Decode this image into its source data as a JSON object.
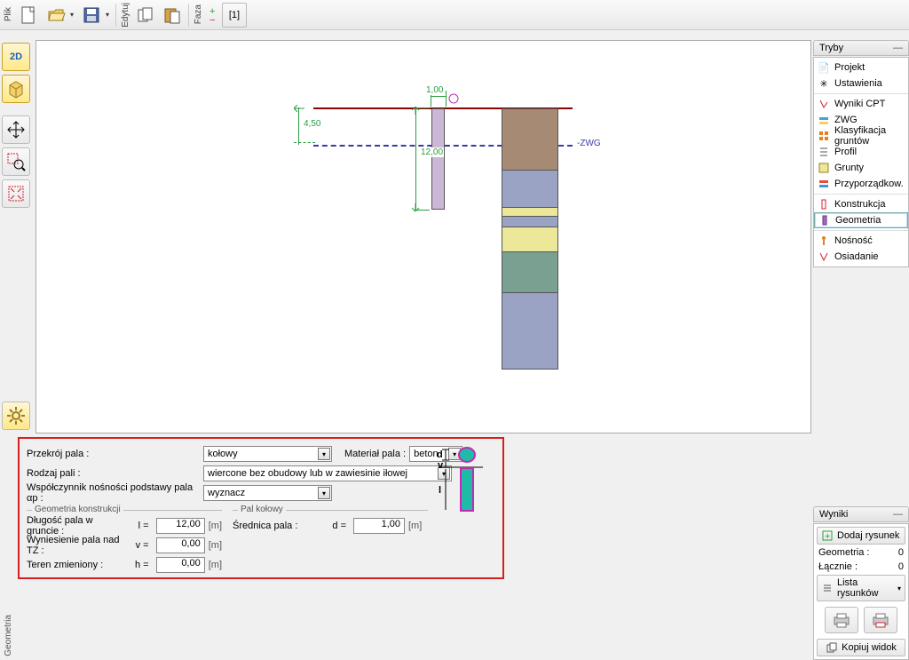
{
  "toolbar": {
    "vlabel_file": "Plik",
    "vlabel_edit": "Edytuj",
    "vlabel_phase": "Faza",
    "phase_btn": "[1]"
  },
  "left": {
    "b2d": "2D",
    "b3d": "3D"
  },
  "right": {
    "modes_header": "Tryby",
    "results_header": "Wyniki",
    "items": [
      "Projekt",
      "Ustawienia",
      "Wyniki CPT",
      "ZWG",
      "Klasyfikacja gruntów",
      "Profil",
      "Grunty",
      "Przyporządkow.",
      "Konstrukcja",
      "Geometria",
      "Nośność",
      "Osiadanie"
    ],
    "add_drawing": "Dodaj rysunek",
    "row_geom_label": "Geometria :",
    "row_geom_val": "0",
    "row_total_label": "Łącznie :",
    "row_total_val": "0",
    "list_drawings": "Lista rysunków",
    "copy_view": "Kopiuj widok"
  },
  "form": {
    "cross_section_label": "Przekrój pala :",
    "cross_section_val": "kołowy",
    "material_label": "Materiał pala :",
    "material_val": "beton",
    "type_label": "Rodzaj pali :",
    "type_val": "wiercone bez obudowy lub w zawiesinie iłowej",
    "coef_label": "Współczynnik nośności podstawy pala αp :",
    "coef_val": "wyznacz",
    "group_geom": "Geometria konstrukcji",
    "group_circ": "Pal kołowy",
    "len_label": "Długość pala w gruncie :",
    "len_var": "l =",
    "len_val": "12,00",
    "len_unit": "[m]",
    "dia_label": "Średnica pala :",
    "dia_var": "d =",
    "dia_val": "1,00",
    "dia_unit": "[m]",
    "rise_label": "Wyniesienie pala nad TZ :",
    "rise_var": "v =",
    "rise_val": "0,00",
    "rise_unit": "[m]",
    "mod_label": "Teren zmieniony :",
    "mod_var": "h =",
    "mod_val": "0,00",
    "mod_unit": "[m]",
    "schem_d": "d",
    "schem_v": "v",
    "schem_l": "l"
  },
  "canvas": {
    "dim_450": "4,50",
    "dim_1200": "12,00",
    "dim_100": "1,00",
    "zwg": "-ZWG"
  },
  "sideLabel": "Geometria"
}
